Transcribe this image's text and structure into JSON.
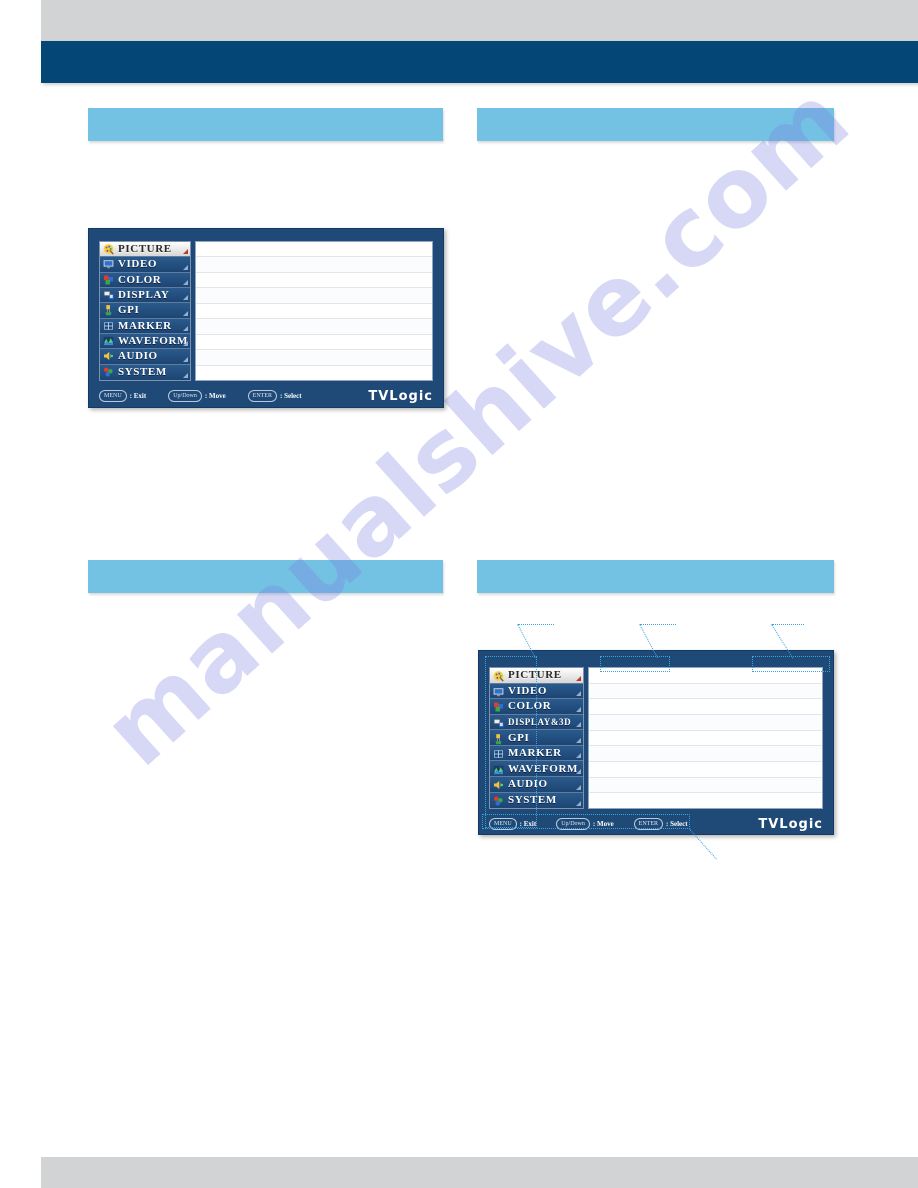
{
  "page": {
    "background_color": "#ffffff",
    "top_band_color": "#d1d3d4",
    "banner_color": "#044676",
    "section_bar_color": "#74c2e3",
    "callout_color": "#3aa3dd",
    "watermark_text": "manualshive.com"
  },
  "banner": {
    "title": ""
  },
  "sections": {
    "top_left": {
      "heading": ""
    },
    "top_right": {
      "heading": ""
    },
    "bottom_left": {
      "heading": ""
    },
    "bottom_right": {
      "heading": ""
    }
  },
  "osd_top": {
    "selected_item": "PICTURE",
    "menu_items": [
      {
        "label": "PICTURE",
        "icon": "palette-icon",
        "selected": true
      },
      {
        "label": "VIDEO",
        "icon": "monitor-icon",
        "selected": false
      },
      {
        "label": "COLOR",
        "icon": "color-swatch-icon",
        "selected": false
      },
      {
        "label": "DISPLAY",
        "icon": "display-icon",
        "selected": false
      },
      {
        "label": "GPI",
        "icon": "plug-icon",
        "selected": false
      },
      {
        "label": "MARKER",
        "icon": "marker-frame-icon",
        "selected": false
      },
      {
        "label": "WAVEFORM",
        "icon": "waveform-icon",
        "selected": false
      },
      {
        "label": "AUDIO",
        "icon": "speaker-icon",
        "selected": false
      },
      {
        "label": "SYSTEM",
        "icon": "system-icon",
        "selected": false
      }
    ],
    "content_row_count": 9,
    "footer": {
      "hints": [
        {
          "key": "MENU",
          "separator": ":",
          "action": "Exit"
        },
        {
          "key": "Up/Down",
          "separator": ":",
          "action": "Move"
        },
        {
          "key": "ENTER",
          "separator": ":",
          "action": "Select"
        }
      ],
      "brand": "TVLogic"
    }
  },
  "osd_bottom": {
    "selected_item": "PICTURE",
    "menu_items": [
      {
        "label": "PICTURE",
        "icon": "palette-icon",
        "selected": true,
        "wide": false
      },
      {
        "label": "VIDEO",
        "icon": "monitor-icon",
        "selected": false,
        "wide": false
      },
      {
        "label": "COLOR",
        "icon": "color-swatch-icon",
        "selected": false,
        "wide": false
      },
      {
        "label": "DISPLAY&3D",
        "icon": "display-icon",
        "selected": false,
        "wide": true
      },
      {
        "label": "GPI",
        "icon": "plug-icon",
        "selected": false,
        "wide": false
      },
      {
        "label": "MARKER",
        "icon": "marker-frame-icon",
        "selected": false,
        "wide": false
      },
      {
        "label": "WAVEFORM",
        "icon": "waveform-icon",
        "selected": false,
        "wide": false
      },
      {
        "label": "AUDIO",
        "icon": "speaker-icon",
        "selected": false,
        "wide": false
      },
      {
        "label": "SYSTEM",
        "icon": "system-icon",
        "selected": false,
        "wide": false
      }
    ],
    "content_row_count": 9,
    "footer": {
      "hints": [
        {
          "key": "MENU",
          "separator": ":",
          "action": "Exit"
        },
        {
          "key": "Up/Down",
          "separator": ":",
          "action": "Move"
        },
        {
          "key": "ENTER",
          "separator": ":",
          "action": "Select"
        }
      ],
      "brand": "TVLogic"
    },
    "callouts": [
      {
        "name": "menu-tree-callout",
        "label": ""
      },
      {
        "name": "menu-title-callout",
        "label": ""
      },
      {
        "name": "menu-status-callout",
        "label": ""
      },
      {
        "name": "menu-footer-callout",
        "label": ""
      }
    ]
  }
}
